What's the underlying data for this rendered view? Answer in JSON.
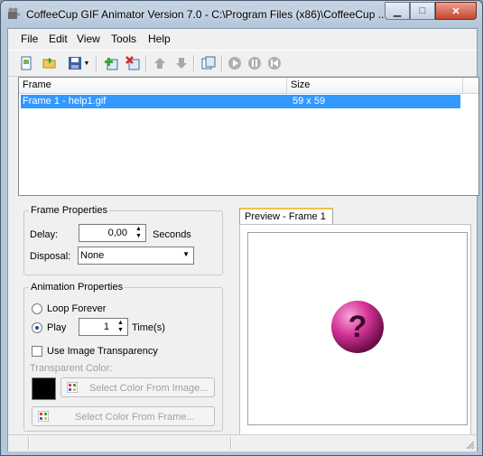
{
  "window": {
    "title": "CoffeeCup GIF Animator Version 7.0 - C:\\Program Files (x86)\\CoffeeCup ..."
  },
  "menu": [
    "File",
    "Edit",
    "View",
    "Tools",
    "Help"
  ],
  "frame_list": {
    "columns": [
      "Frame",
      "Size"
    ],
    "rows": [
      {
        "frame": "Frame 1 - help1.gif",
        "size": "59 x 59"
      }
    ]
  },
  "frame_properties": {
    "title": "Frame Properties",
    "delay_label": "Delay:",
    "delay_value": "0,00",
    "delay_unit": "Seconds",
    "disposal_label": "Disposal:",
    "disposal_value": "None"
  },
  "animation_properties": {
    "title": "Animation Properties",
    "loop_forever": "Loop Forever",
    "play": "Play",
    "play_count": "1",
    "times_label": "Time(s)",
    "use_transparency": "Use Image Transparency",
    "transparent_color_label": "Transparent Color:",
    "select_from_image": "Select Color From Image...",
    "select_from_frame": "Select Color From Frame..."
  },
  "preview": {
    "tab": "Preview - Frame 1"
  },
  "colors": {
    "selection": "#3399ff",
    "tab_accent": "#f3c04a",
    "ball": "#d6349a"
  }
}
